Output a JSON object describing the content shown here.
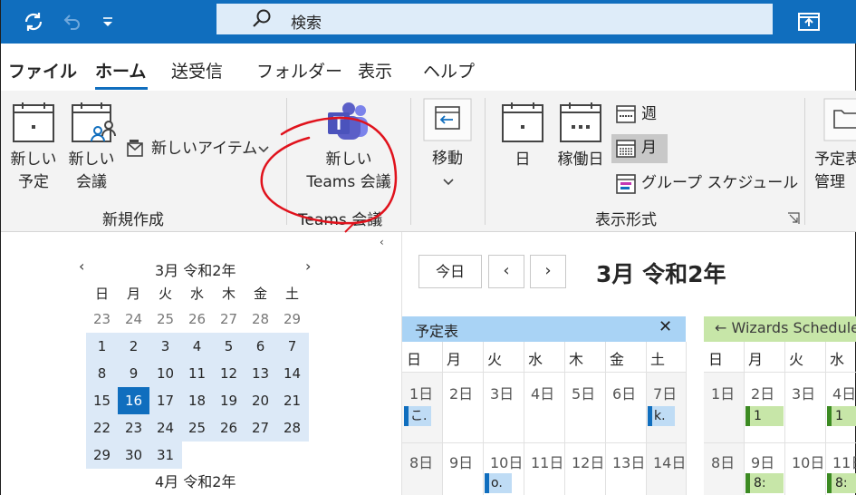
{
  "titlebar": {
    "search_text": "検索"
  },
  "tabs": [
    "ファイル",
    "ホーム",
    "送受信",
    "フォルダー",
    "表示",
    "ヘルプ"
  ],
  "ribbon": {
    "new_appointment": [
      "新しい",
      "予定"
    ],
    "new_meeting": [
      "新しい",
      "会議"
    ],
    "new_items": "新しいアイテム",
    "group_new": "新規作成",
    "teams_meeting": [
      "新しい",
      "Teams 会議"
    ],
    "group_teams": "Teams 会議",
    "move": "移動",
    "day": "日",
    "work_week": "稼働日",
    "week": "週",
    "month": "月",
    "group_schedule": "グループ スケジュール",
    "group_view": "表示形式",
    "manage": [
      "予定表",
      "管理"
    ]
  },
  "mini_calendar": {
    "title": "3月 令和2年",
    "weekdays": [
      "日",
      "月",
      "火",
      "水",
      "木",
      "金",
      "土"
    ],
    "weeks": [
      [
        "23",
        "24",
        "25",
        "26",
        "27",
        "28",
        "29"
      ],
      [
        "1",
        "2",
        "3",
        "4",
        "5",
        "6",
        "7"
      ],
      [
        "8",
        "9",
        "10",
        "11",
        "12",
        "13",
        "14"
      ],
      [
        "15",
        "16",
        "17",
        "18",
        "19",
        "20",
        "21"
      ],
      [
        "22",
        "23",
        "24",
        "25",
        "26",
        "27",
        "28"
      ],
      [
        "29",
        "30",
        "31"
      ]
    ],
    "next_title": "4月 令和2年"
  },
  "main": {
    "today_btn": "今日",
    "title": "3月 令和2年",
    "cal1_name": "予定表",
    "cal2_name": "Wizards Schedule",
    "cal1_weekdays": [
      "日",
      "月",
      "火",
      "水",
      "木",
      "金",
      "土"
    ],
    "cal2_weekdays": [
      "日",
      "月",
      "火",
      "水"
    ],
    "cal1_row1": [
      "1日",
      "2日",
      "3日",
      "4日",
      "5日",
      "6日",
      "7日"
    ],
    "cal1_row2": [
      "8日",
      "9日",
      "10日",
      "11日",
      "12日",
      "13日",
      "14日"
    ],
    "cal2_row1": [
      "1日",
      "2日",
      "3日",
      "4日"
    ],
    "cal2_row2": [
      "8日",
      "9日",
      "10日",
      "11日"
    ],
    "appt1": "こ.",
    "appt2": "k.",
    "appt3": "o.",
    "appt_g1": "1",
    "appt_g2": "1",
    "appt_g3": "8:",
    "appt_g4": "8:"
  },
  "colors": {
    "accent": "#106ebe",
    "cal1": "#a9d3f5",
    "cal2": "#c7e6a8",
    "annotation": "#e0121c"
  }
}
